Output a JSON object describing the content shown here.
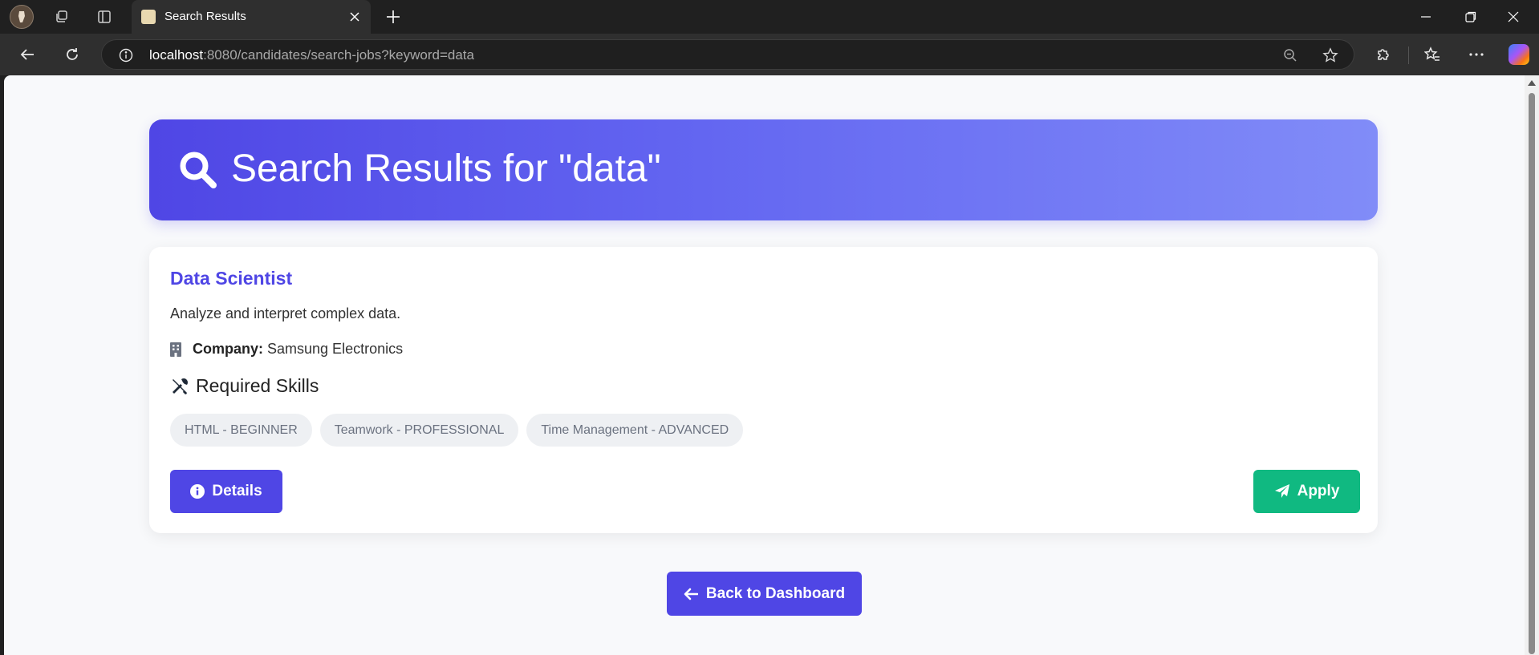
{
  "browser": {
    "tab_title": "Search Results",
    "url_host": "localhost",
    "url_rest": ":8080/candidates/search-jobs?keyword=data"
  },
  "page": {
    "heading": "Search Results for \"data\"",
    "job": {
      "title": "Data Scientist",
      "description": "Analyze and interpret complex data.",
      "company_label": "Company:",
      "company_name": "Samsung Electronics",
      "skills_heading": "Required Skills",
      "skills": [
        "HTML - BEGINNER",
        "Teamwork - PROFESSIONAL",
        "Time Management - ADVANCED"
      ],
      "details_label": "Details",
      "apply_label": "Apply"
    },
    "back_label": "Back to Dashboard"
  },
  "colors": {
    "primary": "#4f46e5",
    "success": "#10b981",
    "page_bg": "#f8f9fb"
  }
}
